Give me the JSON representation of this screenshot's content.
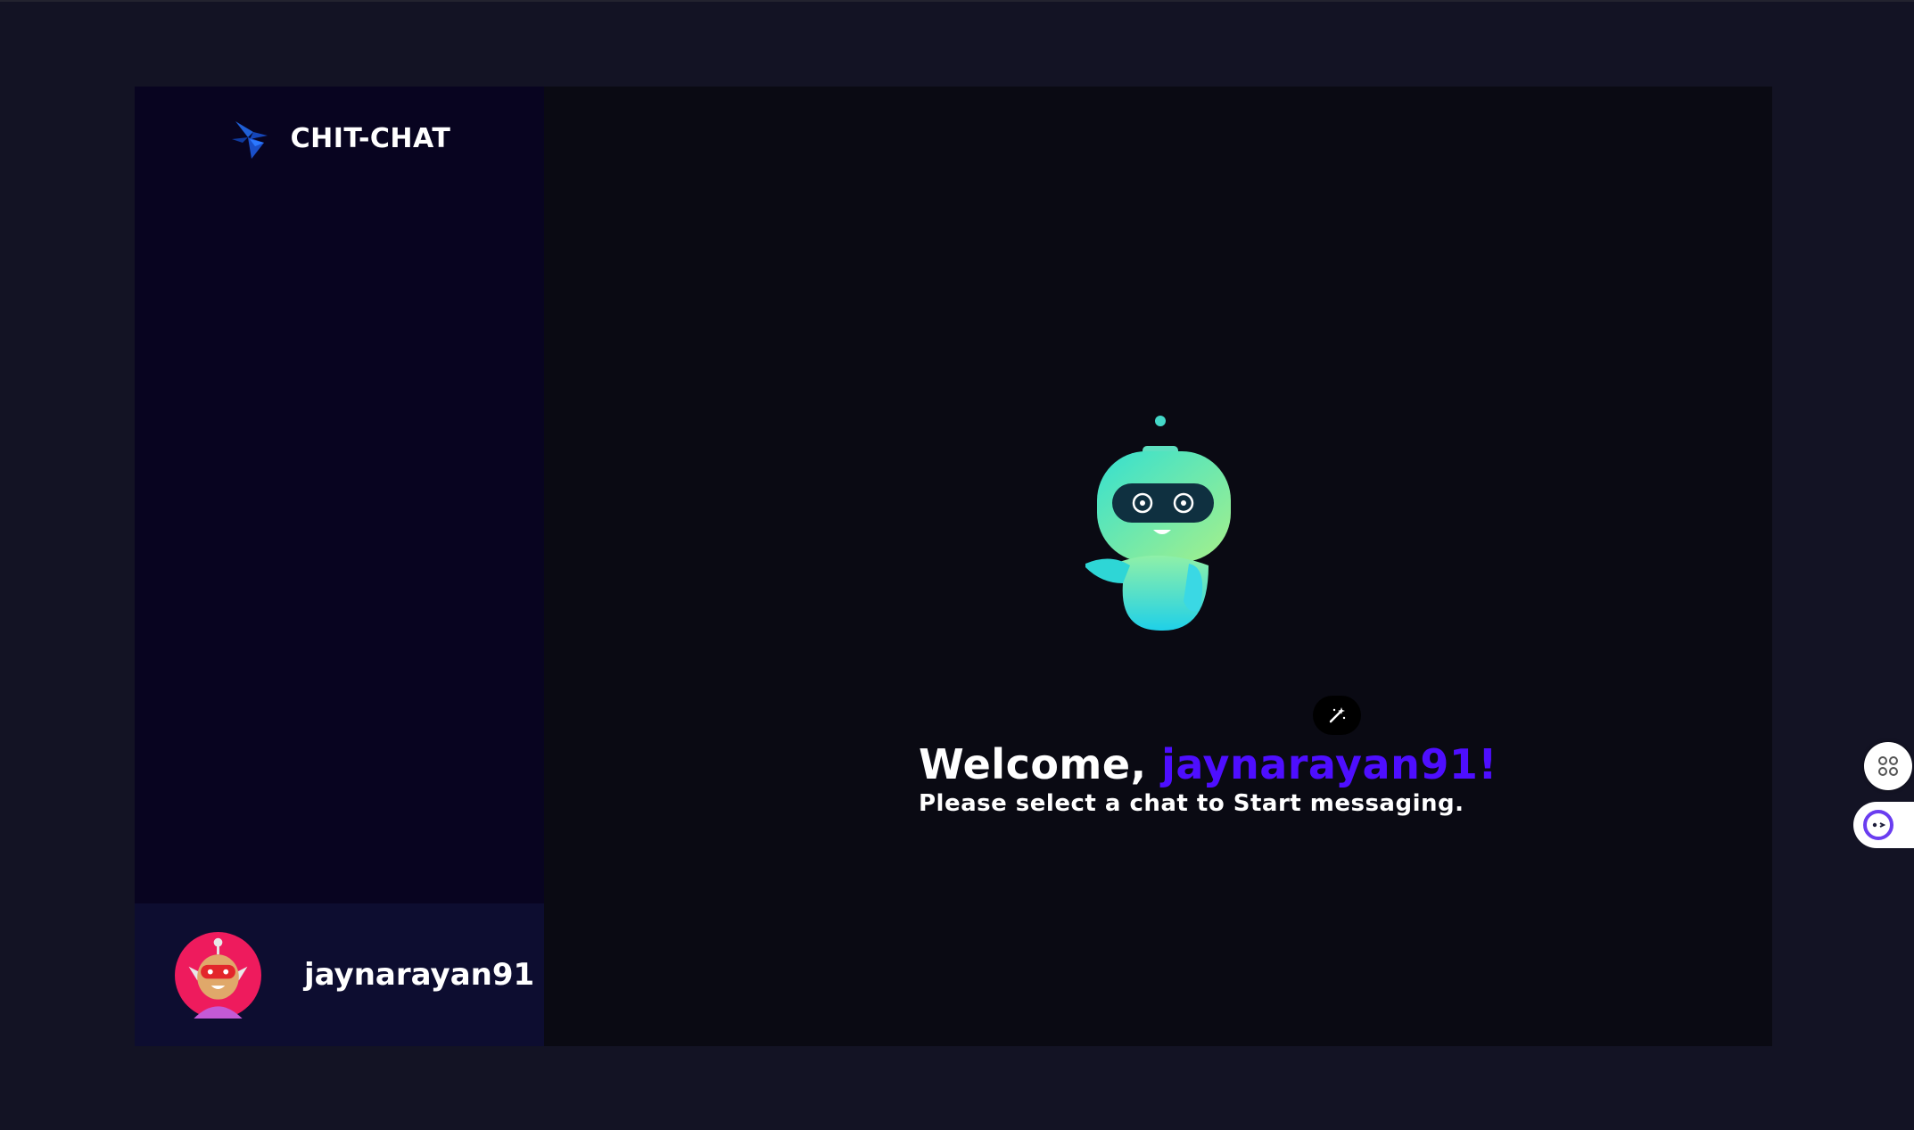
{
  "app": {
    "brand": "CHIT-CHAT",
    "colors": {
      "page_bg": "#131324",
      "sidebar_bg": "#080420",
      "user_panel_bg": "#0d0d30",
      "main_bg": "#0a0a13",
      "accent": "#4e0eff"
    }
  },
  "sidebar": {
    "logo_icon": "logo-icon",
    "current_user": {
      "username": "jaynarayan91",
      "avatar_icon": "robot-avatar-icon"
    }
  },
  "welcome": {
    "greeting": "Welcome, ",
    "name": "jaynarayan91!",
    "subtitle": "Please select a chat to Start messaging.",
    "illustration": "robot-icon",
    "magic_icon": "magic-wand-icon"
  },
  "floating": {
    "extension_icon": "command-icon",
    "assistant_icon": "assistant-face-icon"
  }
}
